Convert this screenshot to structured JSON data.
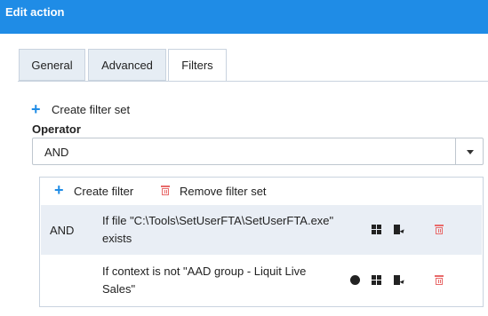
{
  "window": {
    "title": "Edit action"
  },
  "tabs": [
    {
      "label": "General",
      "active": false
    },
    {
      "label": "Advanced",
      "active": false
    },
    {
      "label": "Filters",
      "active": true
    }
  ],
  "toolbar": {
    "create_filter_set_label": "Create filter set"
  },
  "operator": {
    "label": "Operator",
    "value": "AND"
  },
  "panel": {
    "create_filter_label": "Create filter",
    "remove_filter_set_label": "Remove filter set",
    "rows": [
      {
        "operator": "AND",
        "text": "If file \"C:\\Tools\\SetUserFTA\\SetUserFTA.exe\" exists"
      },
      {
        "operator": "",
        "text": "If context is not \"AAD group - Liquit Live Sales\""
      }
    ]
  },
  "colors": {
    "accent": "#1f8ce6",
    "danger": "#e86a6a",
    "selected_row": "#e9eef5"
  }
}
